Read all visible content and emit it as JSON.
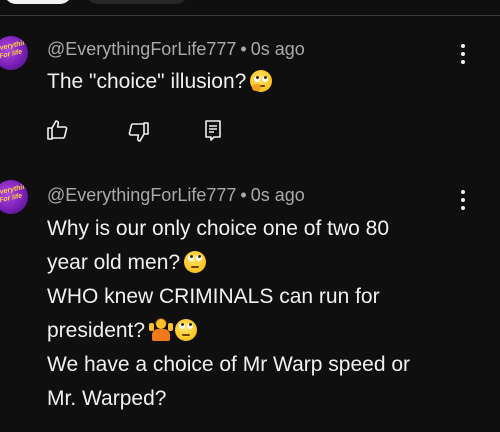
{
  "filter_chips": [
    {
      "label": "",
      "active": true
    },
    {
      "label": "",
      "active": false
    }
  ],
  "comments": [
    {
      "author": "@EverythingForLife777",
      "separator": "•",
      "timestamp": "0s ago",
      "lines": [
        {
          "text": "The \"choice\" illusion?",
          "emoji": [
            "thinking-face-emoji"
          ]
        }
      ],
      "actions": [
        "like-icon",
        "dislike-icon",
        "reply-icon"
      ],
      "menu_icon": "more-vertical-icon"
    },
    {
      "author": "@EverythingForLife777",
      "separator": "•",
      "timestamp": "0s ago",
      "lines": [
        {
          "text": "Why is our only choice one of two 80",
          "emoji": []
        },
        {
          "text": "year old men?",
          "emoji": [
            "eye-roll-emoji"
          ]
        },
        {
          "text": "WHO knew CRIMINALS can run for",
          "emoji": []
        },
        {
          "text": "president?",
          "emoji": [
            "shrug-emoji",
            "eye-roll-emoji"
          ]
        },
        {
          "text": "We have a choice of Mr Warp speed or",
          "emoji": []
        },
        {
          "text": "Mr. Warped?",
          "emoji": []
        }
      ],
      "menu_icon": "more-vertical-icon"
    }
  ],
  "colors": {
    "background": "#0f0f0f",
    "text_primary": "#f1f1f1",
    "text_secondary": "#aaaaaa",
    "avatar": "#7a20b8"
  }
}
